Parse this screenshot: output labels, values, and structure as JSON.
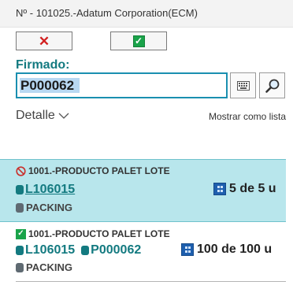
{
  "window": {
    "title": "Nº - 101025.-Adatum Corporation(ECM)"
  },
  "toolbar": {
    "cancel_icon": "✕",
    "ok_icon": "✓"
  },
  "form": {
    "firmado_label": "Firmado:",
    "firmado_value": "P000062",
    "detalle_label": "Detalle",
    "mostrar_label": "Mostrar como lista"
  },
  "lines": [
    {
      "status": "blocked",
      "product": "1001.-PRODUCTO PALET LOTE",
      "lot": "L106015",
      "pallet": "",
      "quantity": "5 de 5 u",
      "packing": "PACKING",
      "selected": true
    },
    {
      "status": "done",
      "product": "1001.-PRODUCTO PALET LOTE",
      "lot": "L106015",
      "pallet": "P000062",
      "quantity": "100 de 100 u",
      "packing": "PACKING",
      "selected": false
    }
  ],
  "colors": {
    "accent": "#137a80",
    "selection": "#b8e6ec",
    "ok": "#1aa34a",
    "cancel": "#d21f1f"
  }
}
